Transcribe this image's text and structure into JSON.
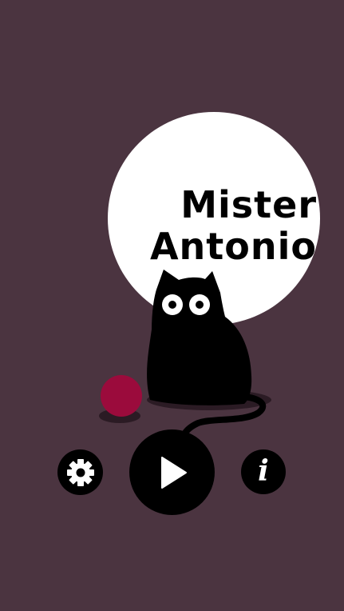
{
  "game": {
    "title_line_1": "Mister",
    "title_line_2": "Antonio"
  },
  "controls": {
    "settings_icon": "gear-icon",
    "play_icon": "play-icon",
    "info_icon": "info-icon",
    "info_glyph": "i"
  },
  "colors": {
    "background": "#4b3440",
    "moon": "#ffffff",
    "cat": "#000000",
    "yarn_ball": "#9b0b3c",
    "shadow": "#2b1b24",
    "button": "#000000",
    "button_icon": "#ffffff"
  }
}
